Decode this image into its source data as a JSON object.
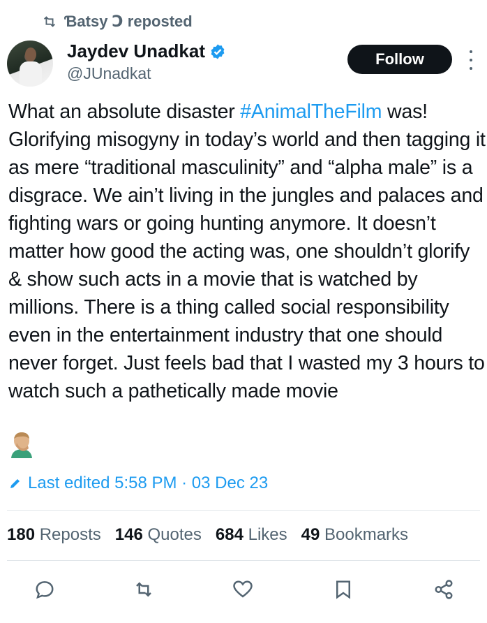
{
  "repost": {
    "text": "Ɓatsy Ↄ reposted"
  },
  "author": {
    "name": "Jaydev Unadkat",
    "handle": "@JUnadkat",
    "verified": true
  },
  "follow_label": "Follow",
  "tweet": {
    "pre": "What an absolute disaster ",
    "hashtag": "#AnimalTheFilm",
    "post": " was! Glorifying misogyny in today’s world and then tagging it as mere “traditional masculinity” and “alpha male” is a disgrace. We ain’t living in the jungles and palaces and fighting wars or going hunting anymore. It doesn’t matter how good the acting was, one shouldn’t glorify & show such acts in a movie that is watched by millions. There is a thing called social responsibility even in the entertainment industry that one should never forget. Just feels bad that I wasted my 3 hours to watch such a pathetically made movie",
    "emoji": "man-facepalming"
  },
  "edited": {
    "text": "Last edited 5:58 PM · 03 Dec 23"
  },
  "stats": {
    "reposts": {
      "count": "180",
      "label": "Reposts"
    },
    "quotes": {
      "count": "146",
      "label": "Quotes"
    },
    "likes": {
      "count": "684",
      "label": "Likes"
    },
    "bookmarks": {
      "count": "49",
      "label": "Bookmarks"
    }
  },
  "colors": {
    "accent": "#1d9bf0",
    "text": "#0f1419",
    "muted": "#536471"
  }
}
